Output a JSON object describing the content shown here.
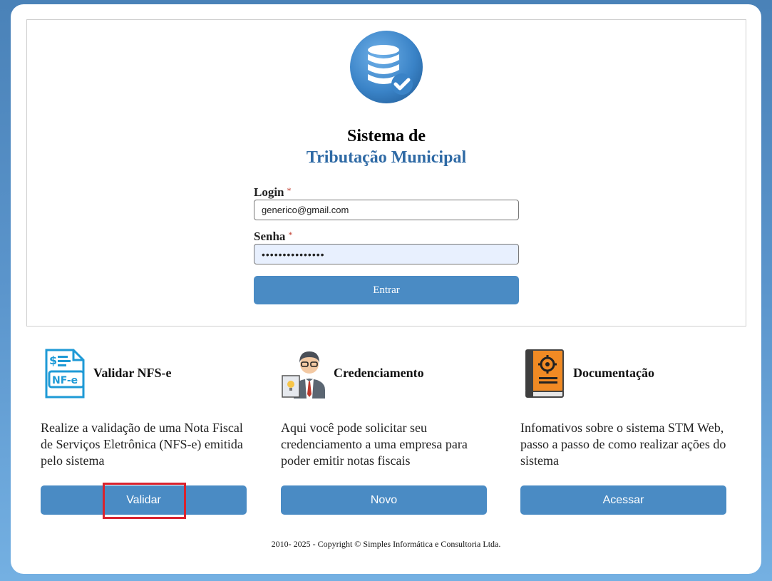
{
  "app": {
    "title_line1": "Sistema de",
    "title_line2": "Tributação Municipal",
    "logo_icon": "database-check-icon"
  },
  "login_form": {
    "login_label": "Login",
    "login_required": "*",
    "login_value": "generico@gmail.com",
    "password_label": "Senha",
    "password_required": "*",
    "password_value": "•••••••••••••••",
    "submit_label": "Entrar"
  },
  "features": [
    {
      "title": "Validar NFS-e",
      "icon": "nfe-document-icon",
      "description": "Realize a validação de uma Nota Fiscal de Serviços Eletrônica (NFS-e) emitida pelo sistema",
      "button_label": "Validar"
    },
    {
      "title": "Credenciamento",
      "icon": "businessman-icon",
      "description": "Aqui você pode solicitar seu credenciamento a uma empresa para poder emitir notas fiscais",
      "button_label": "Novo"
    },
    {
      "title": "Documentação",
      "icon": "manual-book-icon",
      "description": "Infomativos sobre o sistema STM Web, passo a passo de como realizar ações do sistema",
      "button_label": "Acessar"
    }
  ],
  "footer": {
    "copyright": "2010- 2025 - Copyright © Simples Informática e Consultoria Ltda."
  },
  "colors": {
    "primary_button": "#4a8bc4",
    "title_blue": "#2f6aa5",
    "highlight_red": "#d9232e"
  }
}
